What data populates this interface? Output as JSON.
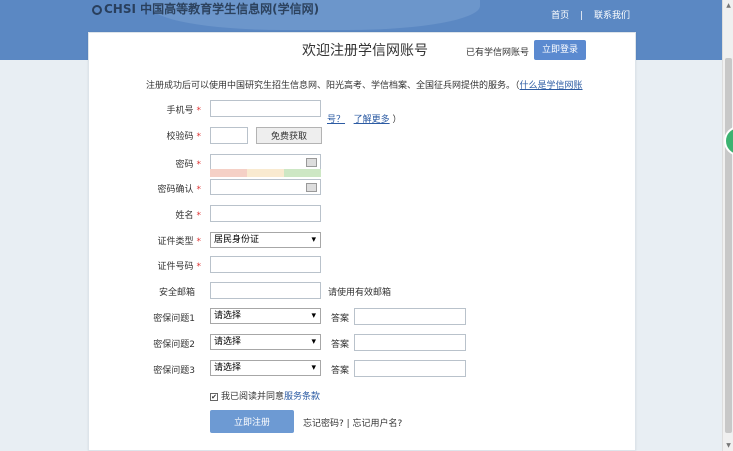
{
  "header": {
    "logo_text": "CHSI 中国高等教育学生信息网(学信网)",
    "nav": {
      "home": "首页",
      "separator": "|",
      "contact": "联系我们"
    }
  },
  "page": {
    "title": "欢迎注册学信网账号",
    "have_account": "已有学信网账号",
    "login_button": "立即登录",
    "intro": "注册成功后可以使用中国研究生招生信息网、阳光高考、学信档案、全国征兵网提供的服务。（",
    "intro_link1": "什么是学信网账",
    "intro_link1b": "号？",
    "intro_link2": "了解更多",
    "intro_close": "）"
  },
  "form": {
    "phone_label": "手机号",
    "code_label": "校验码",
    "code_button": "免费获取",
    "password_label": "密码",
    "password_confirm_label": "密码确认",
    "name_label": "姓名",
    "id_type_label": "证件类型",
    "id_type_value": "居民身份证",
    "id_number_label": "证件号码",
    "email_label": "安全邮箱",
    "email_hint": "请使用有效邮箱",
    "q1_label": "密保问题1",
    "q2_label": "密保问题2",
    "q3_label": "密保问题3",
    "q_placeholder": "请选择",
    "answer_label": "答案",
    "required_mark": "*"
  },
  "footer": {
    "agree_text": "我已阅读并同意",
    "terms": "服务条款",
    "submit": "立即注册",
    "forgot": "忘记密码? | 忘记用户名?"
  },
  "colors": {
    "header_bg": "#5b88c3",
    "primary_button": "#5b8ad0",
    "link": "#2c5ba3",
    "required": "#e03535"
  }
}
